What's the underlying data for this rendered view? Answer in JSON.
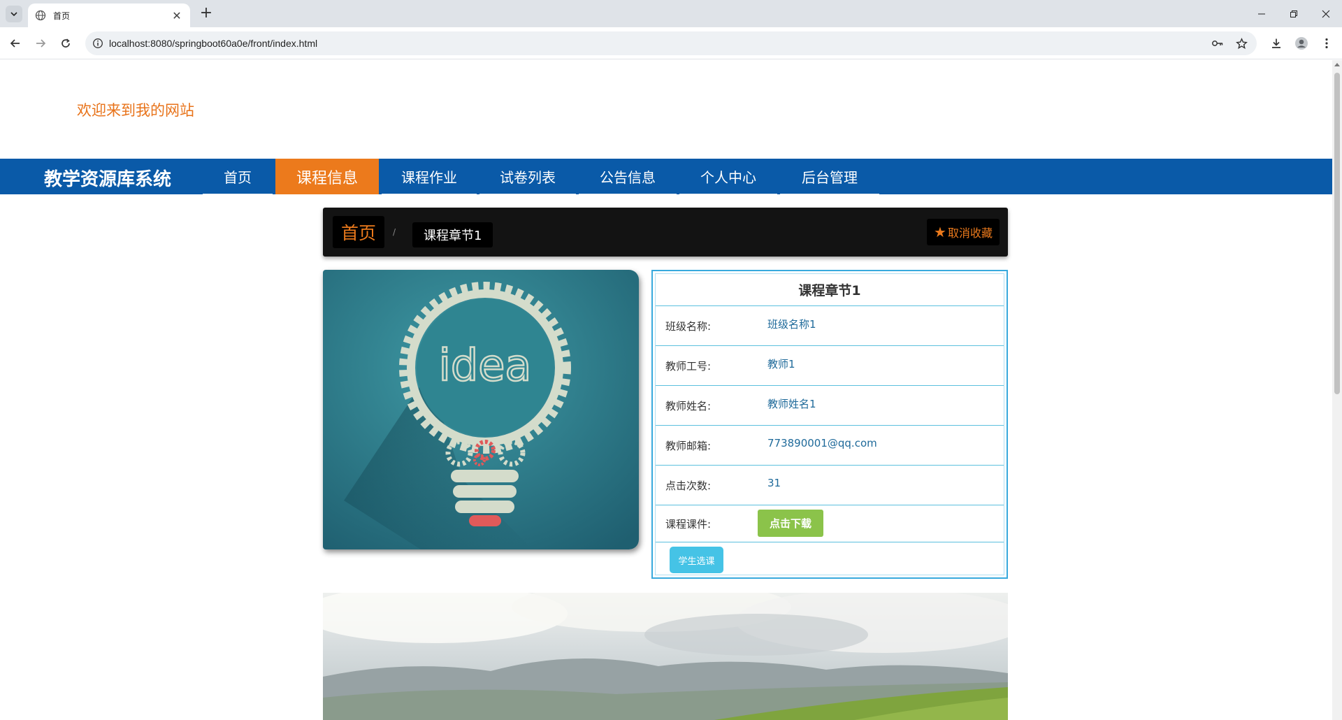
{
  "browser": {
    "tab_title": "首页",
    "url": "localhost:8080/springboot60a0e/front/index.html"
  },
  "site": {
    "welcome": "欢迎来到我的网站",
    "brand": "教学资源库系统",
    "nav": [
      {
        "label": "首页",
        "active": false
      },
      {
        "label": "课程信息",
        "active": true
      },
      {
        "label": "课程作业",
        "active": false
      },
      {
        "label": "试卷列表",
        "active": false
      },
      {
        "label": "公告信息",
        "active": false
      },
      {
        "label": "个人中心",
        "active": false
      },
      {
        "label": "后台管理",
        "active": false
      }
    ]
  },
  "breadcrumb": {
    "home": "首页",
    "separator": "/",
    "current": "课程章节1",
    "favorite_label": "取消收藏"
  },
  "course_image": {
    "text": "idea"
  },
  "detail": {
    "title": "课程章节1",
    "rows": [
      {
        "label": "班级名称:",
        "value": "班级名称1"
      },
      {
        "label": "教师工号:",
        "value": "教师1"
      },
      {
        "label": "教师姓名:",
        "value": "教师姓名1"
      },
      {
        "label": "教师邮箱:",
        "value": "773890001@qq.com"
      },
      {
        "label": "点击次数:",
        "value": "31"
      }
    ],
    "courseware_label": "课程课件:",
    "download_button": "点击下载",
    "select_button": "学生选课"
  },
  "colors": {
    "accent_orange": "#ec7a1c",
    "nav_blue": "#0a5aa8",
    "table_border": "#5bc0de",
    "download_green": "#8bc34a",
    "select_blue": "#45c3e6"
  }
}
